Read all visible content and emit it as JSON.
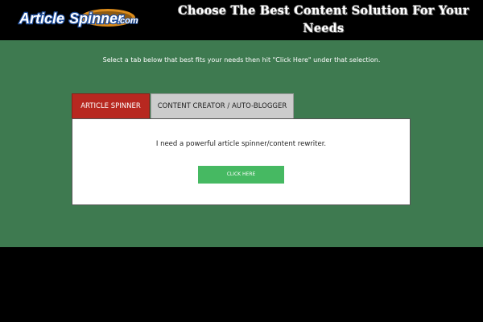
{
  "header": {
    "logo_text": "ArticleSpinner.com",
    "headline": "Choose The Best Content Solution For Your Needs",
    "headline_line1": "Choose The Best Content Solution For Your",
    "headline_line2": "Needs"
  },
  "main": {
    "intro": "Select a tab below that best fits your needs then hit \"Click Here\" under that selection.",
    "tabs": [
      {
        "label": "ARTICLE SPINNER",
        "active": true
      },
      {
        "label": "CONTENT CREATOR / AUTO-BLOGGER",
        "active": false
      }
    ],
    "panel": {
      "text": "I need a powerful article spinner/content rewriter.",
      "button_label": "CLICK HERE"
    }
  },
  "colors": {
    "page_background": "#000000",
    "main_background": "#3e7a50",
    "active_tab": "#b72820",
    "inactive_tab": "#cccccc",
    "button": "#46b962",
    "logo_blue": "#1f4f9e",
    "logo_orange": "#f39a1e"
  },
  "icons": {
    "logo": "article-spinner-logo"
  }
}
